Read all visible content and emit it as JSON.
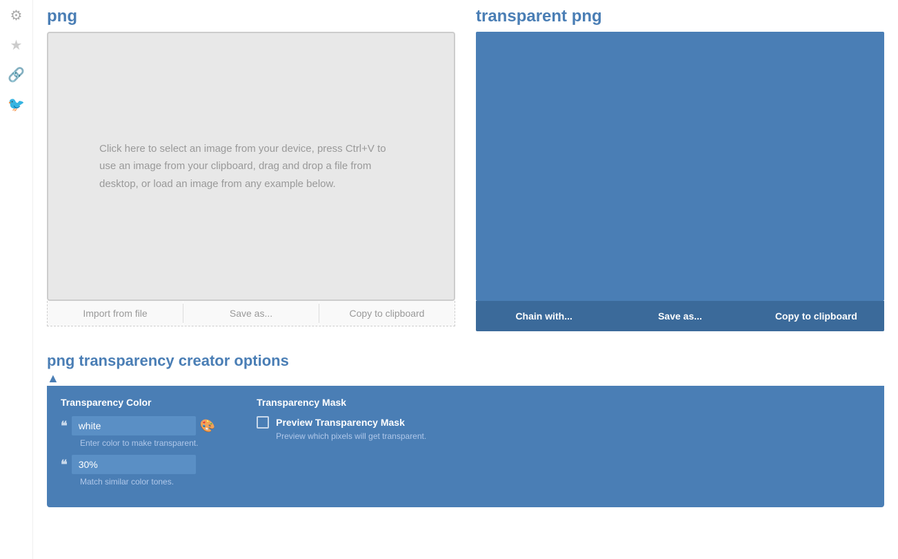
{
  "sidebar": {
    "icons": [
      {
        "name": "gear-icon",
        "symbol": "⚙"
      },
      {
        "name": "star-icon",
        "symbol": "★"
      },
      {
        "name": "link-icon",
        "symbol": "🔗"
      },
      {
        "name": "twitter-icon",
        "symbol": "🐦"
      }
    ]
  },
  "left_panel": {
    "title": "png",
    "upload_text": "Click here to select an image from your device, press Ctrl+V to use an image from your clipboard, drag and drop a file from desktop, or load an image from any example below.",
    "toolbar": {
      "import_label": "Import from file",
      "save_label": "Save as...",
      "copy_label": "Copy to clipboard"
    }
  },
  "right_panel": {
    "title": "transparent png",
    "toolbar": {
      "chain_label": "Chain with...",
      "save_label": "Save as...",
      "copy_label": "Copy to clipboard"
    }
  },
  "options": {
    "title": "png transparency creator options",
    "arrow": "▲",
    "transparency_color": {
      "label": "Transparency Color",
      "color_value": "white",
      "color_placeholder": "white",
      "color_helper": "Enter color to make transparent.",
      "tolerance_value": "30%",
      "tolerance_helper": "Match similar color tones."
    },
    "transparency_mask": {
      "label": "Transparency Mask",
      "checkbox_label": "Preview Transparency Mask",
      "checkbox_helper": "Preview which pixels will get transparent."
    }
  }
}
